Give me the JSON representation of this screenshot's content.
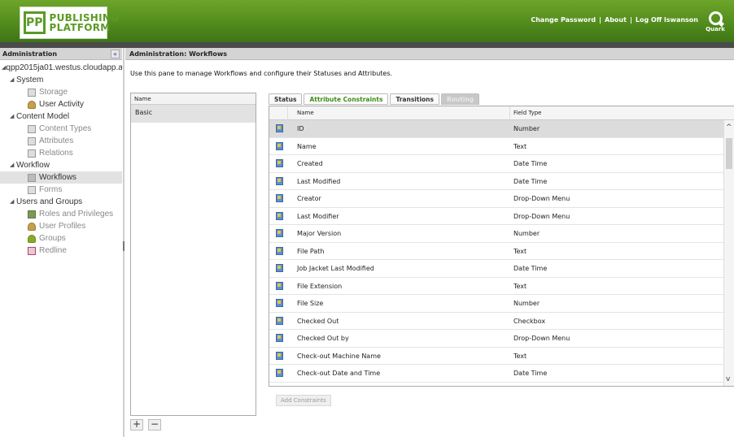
{
  "header": {
    "logo_mark": "PP",
    "logo_line1": "PUBLISHING",
    "logo_line2": "PLATFORM",
    "links": [
      "Change Password",
      "About",
      "Log Off lswanson"
    ],
    "brand_label": "Quark"
  },
  "left_panel": {
    "title": "Administration",
    "collapse_label": "«",
    "tree": [
      {
        "label": "qpp2015ja01.westus.cloudapp.a",
        "level": 0,
        "icon": "caret"
      },
      {
        "label": "System",
        "level": 1,
        "icon": "caret"
      },
      {
        "label": "Storage",
        "level": 2,
        "icon": "storage-icon",
        "gray": true
      },
      {
        "label": "User Activity",
        "level": 2,
        "icon": "user-activity-icon"
      },
      {
        "label": "Content Model",
        "level": 1,
        "icon": "caret"
      },
      {
        "label": "Content Types",
        "level": 2,
        "icon": "content-types-icon",
        "gray": true
      },
      {
        "label": "Attributes",
        "level": 2,
        "icon": "attributes-icon",
        "gray": true
      },
      {
        "label": "Relations",
        "level": 2,
        "icon": "relations-icon",
        "gray": true
      },
      {
        "label": "Workflow",
        "level": 1,
        "icon": "caret"
      },
      {
        "label": "Workflows",
        "level": 2,
        "icon": "workflows-icon",
        "selected": true
      },
      {
        "label": "Forms",
        "level": 2,
        "icon": "forms-icon",
        "gray": true
      },
      {
        "label": "Users and Groups",
        "level": 1,
        "icon": "caret"
      },
      {
        "label": "Roles and Privileges",
        "level": 2,
        "icon": "roles-icon",
        "gray": true
      },
      {
        "label": "User Profiles",
        "level": 2,
        "icon": "user-profiles-icon",
        "gray": true
      },
      {
        "label": "Groups",
        "level": 2,
        "icon": "groups-icon",
        "gray": true
      },
      {
        "label": "Redline",
        "level": 2,
        "icon": "redline-icon",
        "gray": true
      }
    ]
  },
  "main": {
    "title": "Administration: Workflows",
    "description": "Use this pane to manage Workflows and configure their Statuses and Attributes.",
    "workflow_list": {
      "header": "Name",
      "items": [
        "Basic"
      ]
    },
    "add_label": "+",
    "remove_label": "−",
    "tabs": [
      {
        "label": "Status",
        "state": "normal"
      },
      {
        "label": "Attribute Constraints",
        "state": "active"
      },
      {
        "label": "Transitions",
        "state": "normal"
      },
      {
        "label": "Routing",
        "state": "disabled"
      }
    ],
    "grid": {
      "columns": [
        "Name",
        "Field Type"
      ],
      "rows": [
        {
          "name": "ID",
          "type": "Number"
        },
        {
          "name": "Name",
          "type": "Text"
        },
        {
          "name": "Created",
          "type": "Date Time"
        },
        {
          "name": "Last Modified",
          "type": "Date Time"
        },
        {
          "name": "Creator",
          "type": "Drop-Down Menu"
        },
        {
          "name": "Last Modifier",
          "type": "Drop-Down Menu"
        },
        {
          "name": "Major Version",
          "type": "Number"
        },
        {
          "name": "File Path",
          "type": "Text"
        },
        {
          "name": "Job Jacket Last Modified",
          "type": "Date Time"
        },
        {
          "name": "File Extension",
          "type": "Text"
        },
        {
          "name": "File Size",
          "type": "Number"
        },
        {
          "name": "Checked Out",
          "type": "Checkbox"
        },
        {
          "name": "Checked Out by",
          "type": "Drop-Down Menu"
        },
        {
          "name": "Check-out Machine Name",
          "type": "Text"
        },
        {
          "name": "Check-out Date and Time",
          "type": "Date Time"
        }
      ]
    },
    "add_constraints_label": "Add Constraints"
  },
  "colors": {
    "header_green": "#4f8a1c",
    "active_tab_text": "#3f8a16"
  }
}
